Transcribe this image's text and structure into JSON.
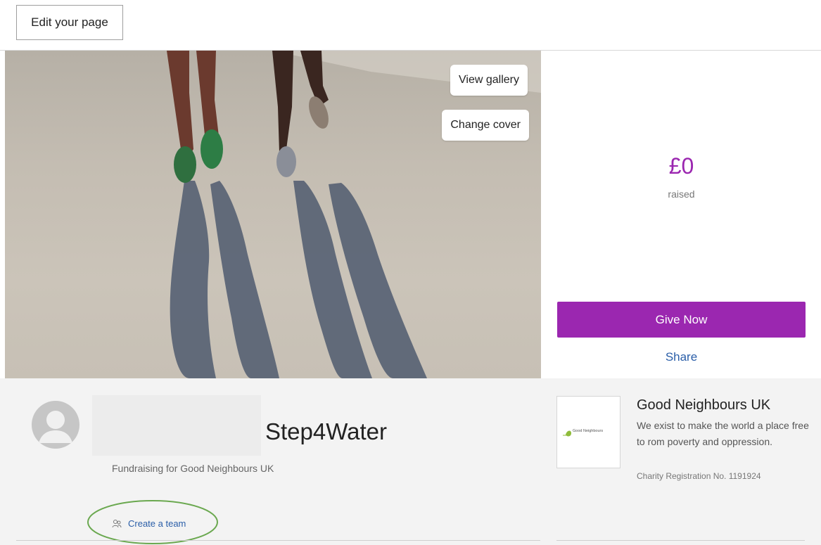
{
  "header": {
    "edit_label": "Edit your page"
  },
  "cover": {
    "view_gallery_label": "View gallery",
    "change_cover_label": "Change cover"
  },
  "donation": {
    "amount": "£0",
    "raised_label": "raised",
    "give_label": "Give Now",
    "share_label": "Share"
  },
  "profile": {
    "title": "Step4Water",
    "subtitle": "Fundraising for Good Neighbours UK",
    "create_team_label": "Create a team"
  },
  "charity": {
    "name": "Good Neighbours UK",
    "description": "We exist to make the world a place free to rom poverty and oppression.",
    "registration": "Charity Registration No. 1191924",
    "logo_text": "Good Neighbours"
  },
  "colors": {
    "brand": "#9b27b0",
    "link": "#2a5ea8",
    "highlight": "#6aa84f"
  }
}
